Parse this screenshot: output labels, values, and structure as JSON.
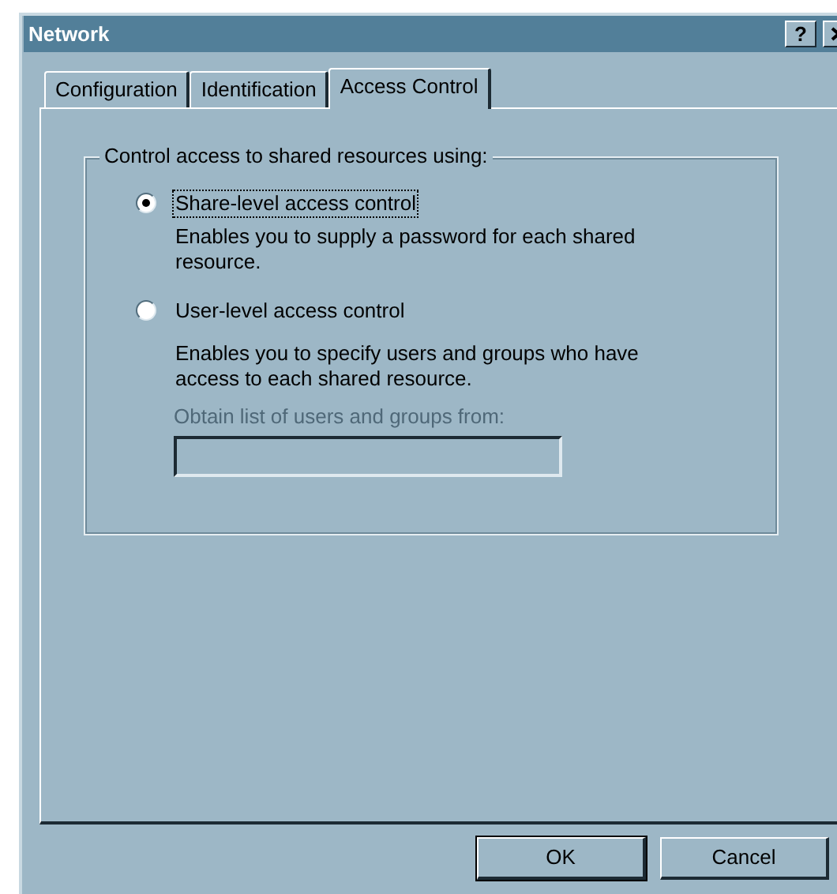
{
  "window": {
    "title": "Network",
    "help_button": "?"
  },
  "tabs": [
    {
      "label": "Configuration",
      "selected": false
    },
    {
      "label": "Identification",
      "selected": false
    },
    {
      "label": "Access Control",
      "selected": true
    }
  ],
  "group": {
    "title": "Control access to shared resources using:",
    "options": [
      {
        "label": "Share-level access control",
        "description": "Enables you to supply a password for each shared resource.",
        "selected": true,
        "focused": true
      },
      {
        "label": "User-level access control",
        "description": "Enables you to specify users and groups who have access to each shared resource.",
        "selected": false,
        "focused": false
      }
    ],
    "source": {
      "label": "Obtain list of users and groups from:",
      "disabled": true
    }
  },
  "buttons": [
    {
      "label": "OK",
      "default": true
    },
    {
      "label": "Cancel",
      "default": false
    }
  ]
}
